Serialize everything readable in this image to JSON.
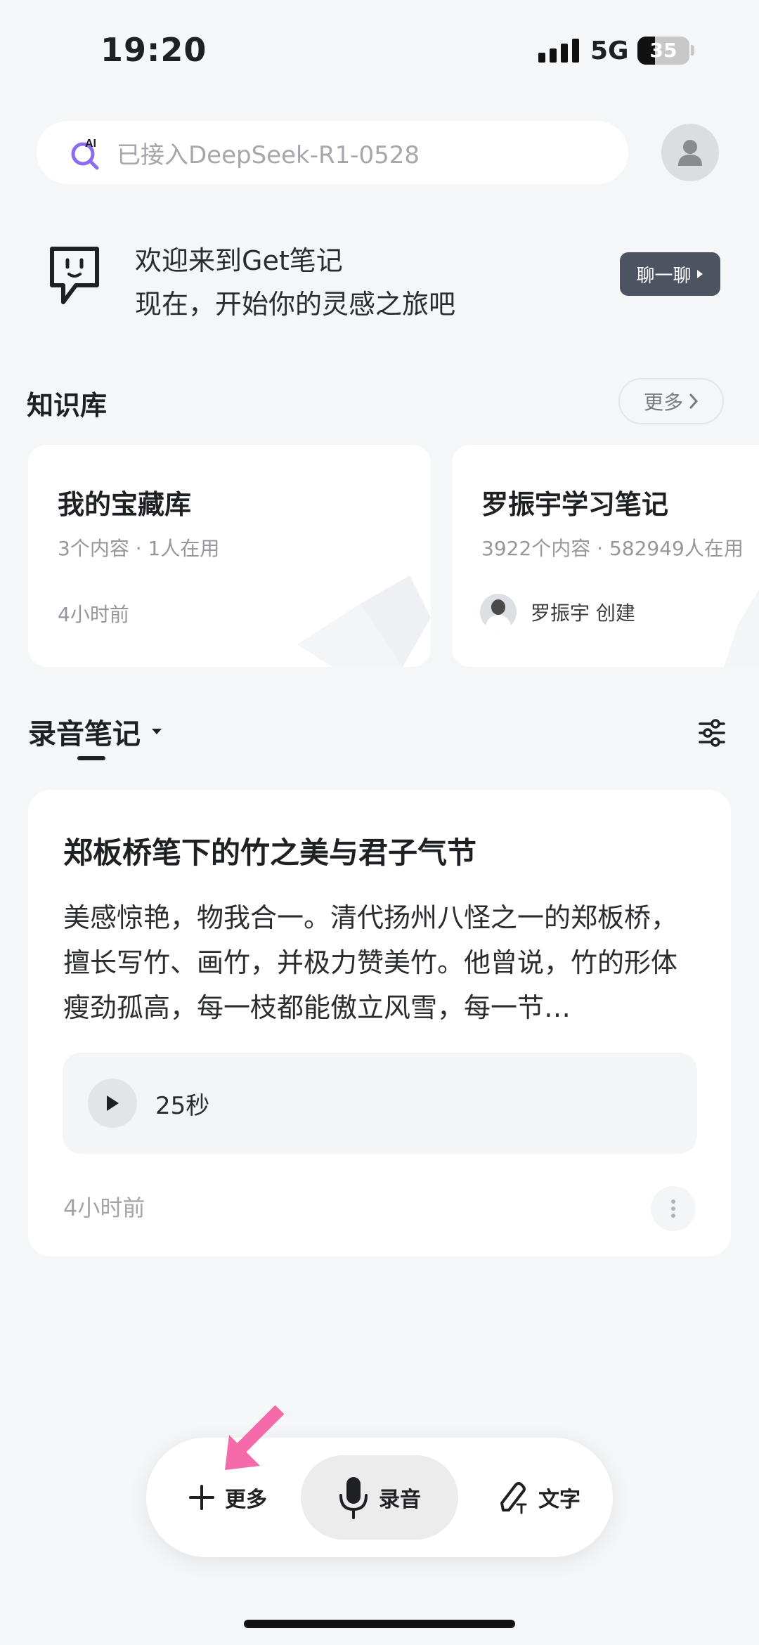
{
  "status": {
    "time": "19:20",
    "network": "5G",
    "battery": "35"
  },
  "search": {
    "placeholder": "已接入DeepSeek-R1-0528",
    "ai_badge": "AI"
  },
  "welcome": {
    "title": "欢迎来到Get笔记",
    "subtitle": "现在，开始你的灵感之旅吧",
    "chat_button": "聊一聊"
  },
  "knowledge": {
    "title": "知识库",
    "more": "更多",
    "cards": [
      {
        "title": "我的宝藏库",
        "meta": "3个内容 · 1人在用",
        "time": "4小时前"
      },
      {
        "title": "罗振宇学习笔记",
        "meta": "3922个内容 · 582949人在用",
        "author": "罗振宇 创建"
      }
    ]
  },
  "recordings": {
    "title": "录音笔记",
    "note": {
      "title": "郑板桥笔下的竹之美与君子气节",
      "body": "美感惊艳，物我合一。清代扬州八怪之一的郑板桥，擅长写竹、画竹，并极力赞美竹。他曾说，竹的形体瘦劲孤高，每一枝都能傲立风雪，每一节…",
      "duration": "25秒",
      "time": "4小时前"
    }
  },
  "bottom_bar": {
    "more": "更多",
    "record": "录音",
    "text": "文字"
  },
  "colors": {
    "accent_arrow": "#f56aa8",
    "chat_button": "#4d5461",
    "ai_icon": "#8b6cf0"
  }
}
